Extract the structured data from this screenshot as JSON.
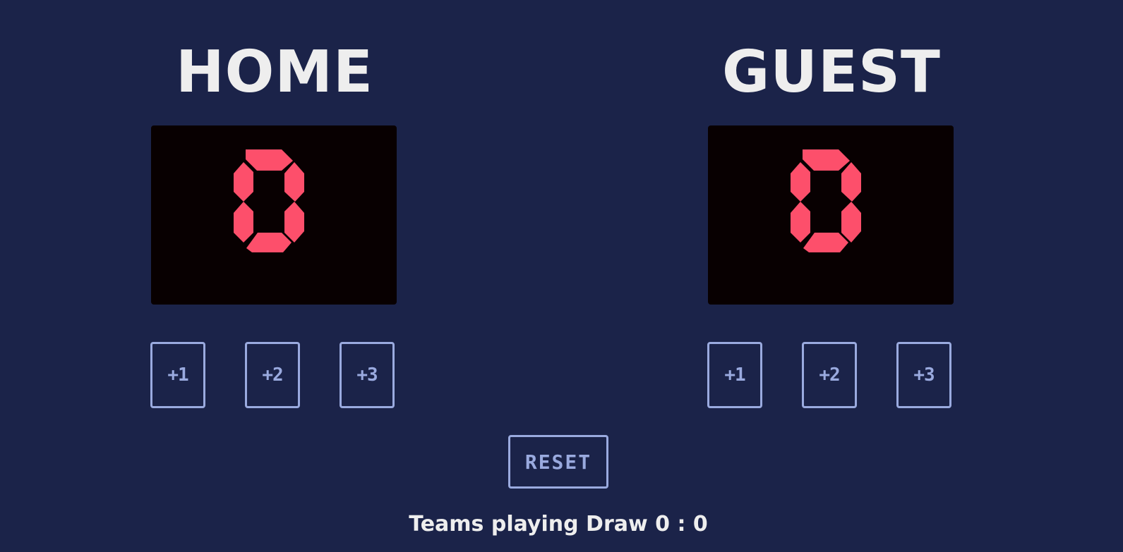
{
  "colors": {
    "background": "#1b2349",
    "title_text": "#eeeeee",
    "scoreboard": "#080001",
    "digit": "#fd4f6b",
    "button_accent": "#9aaadf"
  },
  "home": {
    "name": "HOME",
    "score": "0",
    "buttons": [
      "+1",
      "+2",
      "+3"
    ]
  },
  "guest": {
    "name": "GUEST",
    "score": "0",
    "buttons": [
      "+1",
      "+2",
      "+3"
    ]
  },
  "reset_label": "RESET",
  "status_text": "Teams playing Draw 0 : 0"
}
